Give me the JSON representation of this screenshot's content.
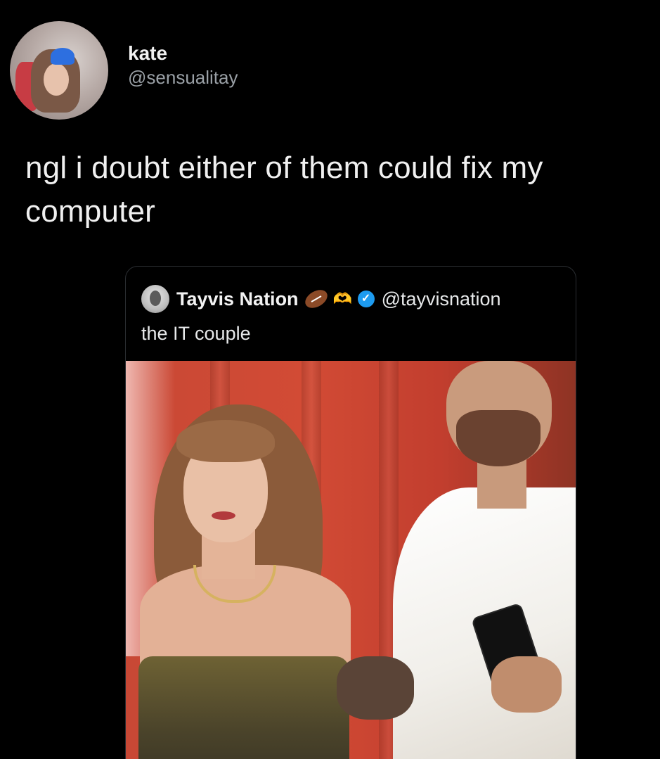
{
  "post": {
    "author": {
      "display_name": "kate",
      "handle": "@sensualitay",
      "avatar_icon": "profile-avatar"
    },
    "text": "ngl i doubt either of them could fix my computer"
  },
  "quoted_post": {
    "author": {
      "display_name": "Tayvis Nation",
      "handle": "@tayvisnation",
      "emojis": [
        "american-football-emoji",
        "heart-hands-emoji"
      ],
      "verified": true,
      "verified_color": "#1d9bf0"
    },
    "text": "the IT couple",
    "media": {
      "type": "photo",
      "description_icon": "couple-photo"
    }
  },
  "colors": {
    "background": "#000000",
    "text_primary": "#f0f0f0",
    "text_secondary": "#9aa0a6"
  }
}
